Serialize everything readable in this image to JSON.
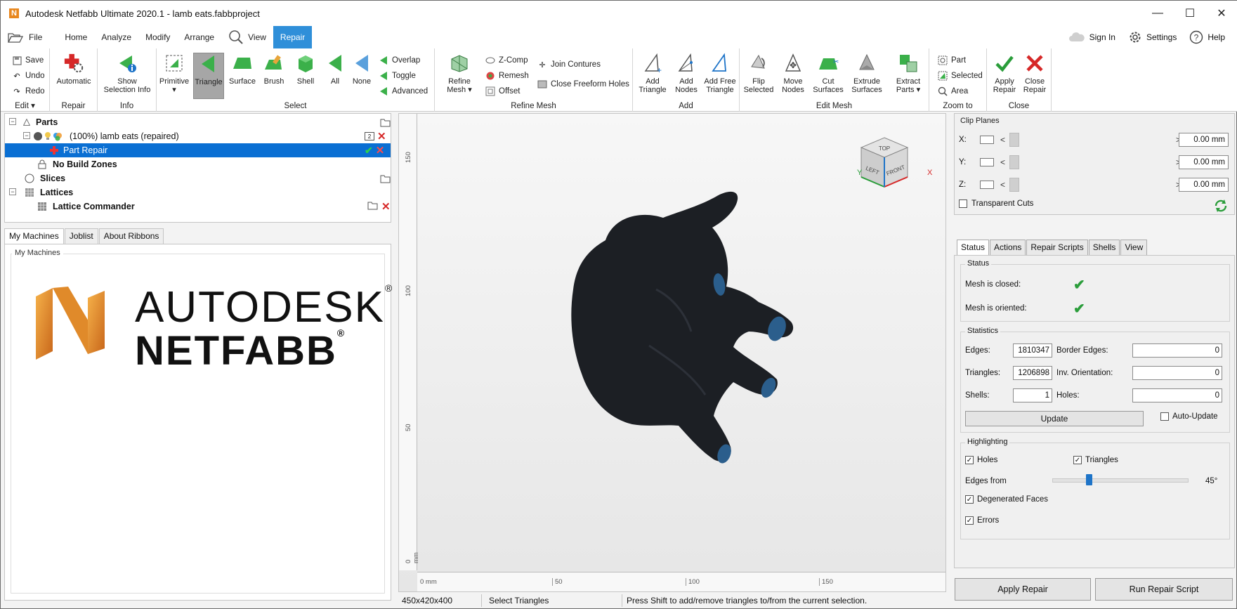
{
  "window": {
    "title": "Autodesk Netfabb Ultimate 2020.1 - lamb eats.fabbproject",
    "app_logo_letter": "N",
    "minimize_glyph": "—",
    "maximize_glyph": "☐",
    "close_glyph": "✕"
  },
  "menu": {
    "file": "File",
    "home": "Home",
    "analyze": "Analyze",
    "modify": "Modify",
    "arrange": "Arrange",
    "view": "View",
    "repair": "Repair",
    "sign_in": "Sign In",
    "settings": "Settings",
    "help": "Help"
  },
  "ribbon": {
    "edit": {
      "save": "Save",
      "undo": "Undo",
      "redo": "Redo",
      "label": "Edit ▾"
    },
    "repair": {
      "automatic": "Automatic",
      "label": "Repair"
    },
    "info": {
      "show_selection_info_1": "Show",
      "show_selection_info_2": "Selection Info",
      "label": "Info"
    },
    "select": {
      "primitive": "Primitive",
      "primitive_arrow": "▾",
      "triangle": "Triangle",
      "surface": "Surface",
      "brush": "Brush",
      "shell": "Shell",
      "all": "All",
      "none": "None",
      "overlap": "Overlap",
      "toggle": "Toggle",
      "advanced": "Advanced",
      "label": "Select"
    },
    "refine_mesh": {
      "refine_mesh_1": "Refine",
      "refine_mesh_2": "Mesh ▾",
      "zcomp": "Z-Comp",
      "remesh": "Remesh",
      "offset": "Offset",
      "join_contures": "Join Contures",
      "close_freeform_holes": "Close Freeform Holes",
      "label": "Refine Mesh"
    },
    "add": {
      "add_triangle_1": "Add",
      "add_triangle_2": "Triangle",
      "add_nodes_1": "Add",
      "add_nodes_2": "Nodes",
      "add_free_triangle_1": "Add Free",
      "add_free_triangle_2": "Triangle",
      "label": "Add"
    },
    "edit_mesh": {
      "flip_selected_1": "Flip",
      "flip_selected_2": "Selected",
      "move_nodes_1": "Move",
      "move_nodes_2": "Nodes",
      "cut_surfaces_1": "Cut",
      "cut_surfaces_2": "Surfaces",
      "extrude_surfaces_1": "Extrude",
      "extrude_surfaces_2": "Surfaces",
      "extract_parts_1": "Extract",
      "extract_parts_2": "Parts ▾",
      "label": "Edit Mesh"
    },
    "zoom_to": {
      "part": "Part",
      "selected": "Selected",
      "area": "Area",
      "label": "Zoom to"
    },
    "close": {
      "apply_repair_1": "Apply",
      "apply_repair_2": "Repair",
      "close_repair_1": "Close",
      "close_repair_2": "Repair",
      "label": "Close"
    }
  },
  "tree": {
    "parts": "Parts",
    "lamb": "(100%) lamb eats (repaired)",
    "lamb_badge": "2",
    "part_repair": "Part Repair",
    "no_build_zones": "No Build Zones",
    "slices": "Slices",
    "lattices": "Lattices",
    "lattice_commander": "Lattice Commander"
  },
  "left_tabs": {
    "my_machines": "My Machines",
    "joblist": "Joblist",
    "about_ribbons": "About Ribbons"
  },
  "machines": {
    "legend": "My Machines",
    "brand_line1": "AUTODESK",
    "brand_line2": "NETFABB",
    "reg": "®"
  },
  "viewport": {
    "ruler_v": [
      "150",
      "100",
      "50",
      "0 mm"
    ],
    "ruler_h": [
      "0 mm",
      "50",
      "100",
      "150"
    ],
    "axis_y": "Y",
    "axis_x": "X",
    "cube_top": "TOP",
    "cube_left": "LEFT",
    "cube_front": "FRONT"
  },
  "clip_planes": {
    "title": "Clip Planes",
    "rows": [
      {
        "axis": "X:",
        "value": "0.00 mm"
      },
      {
        "axis": "Y:",
        "value": "0.00 mm"
      },
      {
        "axis": "Z:",
        "value": "0.00 mm"
      }
    ],
    "left_arrow": "<",
    "right_arrow": ">",
    "transparent_cuts": "Transparent Cuts"
  },
  "right_tabs": {
    "status": "Status",
    "actions": "Actions",
    "repair_scripts": "Repair Scripts",
    "shells": "Shells",
    "view": "View"
  },
  "status": {
    "legend": "Status",
    "mesh_closed": "Mesh is closed:",
    "mesh_oriented": "Mesh is oriented:"
  },
  "statistics": {
    "legend": "Statistics",
    "edges_label": "Edges:",
    "edges": "1810347",
    "border_edges_label": "Border Edges:",
    "border_edges": "0",
    "triangles_label": "Triangles:",
    "triangles": "1206898",
    "inv_orientation_label": "Inv. Orientation:",
    "inv_orientation": "0",
    "shells_label": "Shells:",
    "shells": "1",
    "holes_label": "Holes:",
    "holes": "0",
    "update": "Update",
    "auto_update": "Auto-Update"
  },
  "highlighting": {
    "legend": "Highlighting",
    "holes": "Holes",
    "triangles": "Triangles",
    "edges_from": "Edges from",
    "edges_from_value": "45°",
    "edges_from_fraction": 0.26,
    "degenerated_faces": "Degenerated Faces",
    "errors": "Errors"
  },
  "bottom_buttons": {
    "apply_repair": "Apply Repair",
    "run_repair_script": "Run Repair Script"
  },
  "statusbar": {
    "dimensions": "450x420x400",
    "mode": "Select Triangles",
    "hint": "Press Shift to add/remove triangles to/from the current selection."
  },
  "colors": {
    "accent": "#2f8fd9",
    "selection": "#0a6fd3",
    "ok_green": "#2a9d3a",
    "error_red": "#d62828",
    "mesh": "#1c1f24"
  }
}
